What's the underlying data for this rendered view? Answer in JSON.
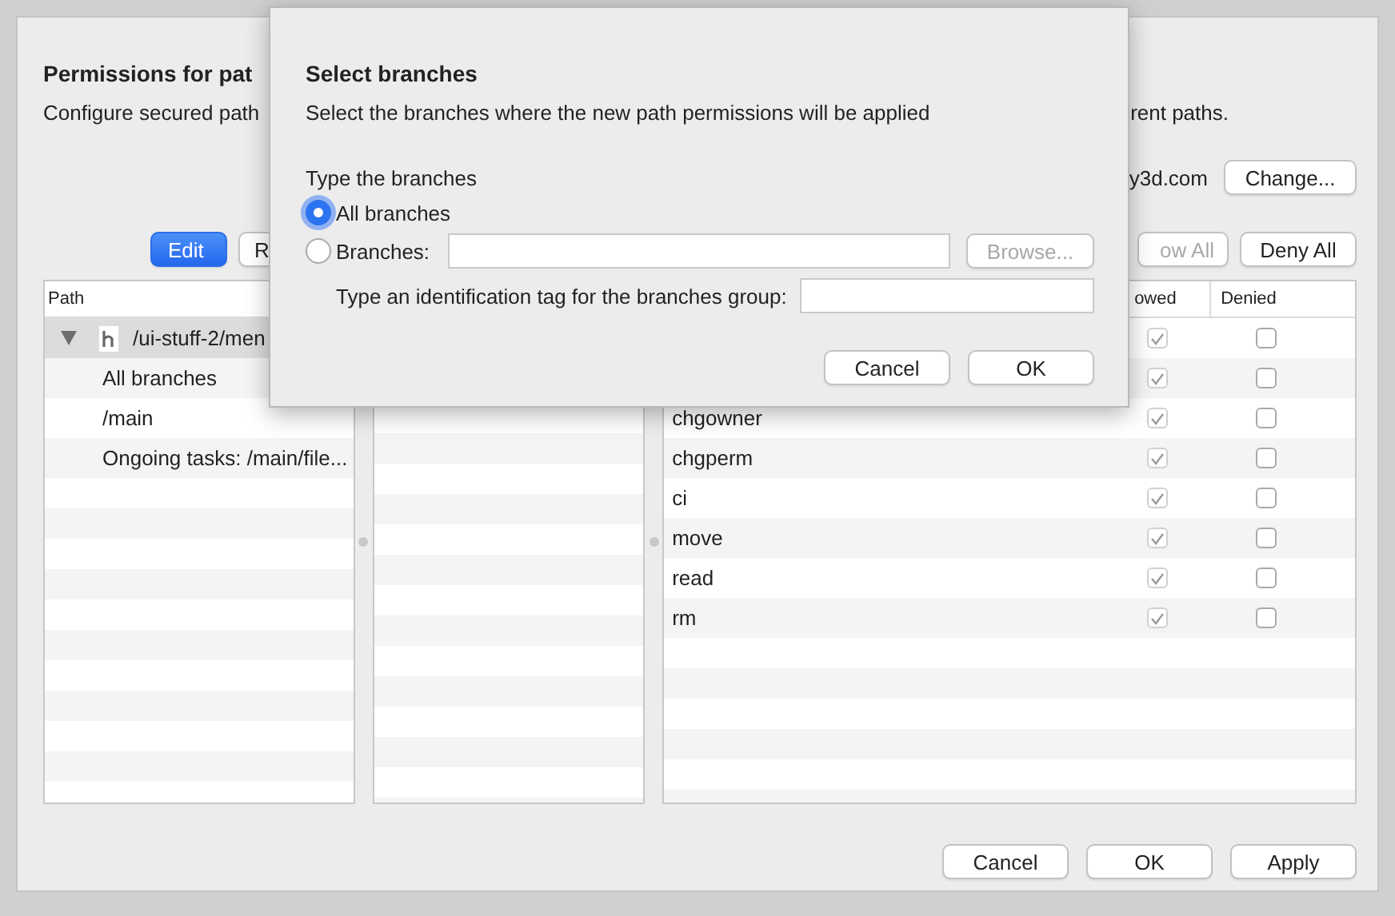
{
  "sheet": {
    "title": "Permissions for pat",
    "description": "Configure secured path",
    "description_end": "rent paths.",
    "account": "y3d.com",
    "change_button": "Change...",
    "toolbar_left": [
      {
        "label": "Edit",
        "kind": "primary"
      },
      {
        "label": "R",
        "kind": "normal"
      }
    ],
    "toolbar_right": [
      {
        "label": "ow All",
        "disabled": true
      },
      {
        "label": "Deny All",
        "disabled": false
      }
    ]
  },
  "path_table": {
    "columns": [
      "Path"
    ],
    "rows": [
      {
        "label": "/ui-stuff-2/men",
        "expanded": true,
        "selected": true,
        "children": [
          {
            "label": "All branches",
            "selected": false
          },
          {
            "label": "/main",
            "selected": false
          },
          {
            "label": "Ongoing tasks: /main/file...",
            "selected": false
          }
        ]
      }
    ]
  },
  "permissions": {
    "columns": [
      "owed",
      "Denied"
    ],
    "rows": [
      {
        "allowed": true,
        "denied": false
      },
      {
        "allowed": true,
        "denied": false
      },
      {
        "name": "chgowner",
        "allowed": true,
        "denied": false
      },
      {
        "name": "chgperm",
        "allowed": true,
        "denied": false
      },
      {
        "name": "ci",
        "allowed": true,
        "denied": false
      },
      {
        "name": "move",
        "allowed": true,
        "denied": false
      },
      {
        "name": "read",
        "allowed": true,
        "denied": false
      },
      {
        "name": "rm",
        "allowed": true,
        "denied": false
      }
    ]
  },
  "footer_buttons": [
    "Cancel",
    "OK",
    "Apply"
  ],
  "dialog": {
    "title": "Select branches",
    "description": "Select the branches where the new path permissions will be applied",
    "group_label": "Type the branches",
    "options": [
      {
        "label": "All branches",
        "selected": true
      },
      {
        "label": "Branches:",
        "selected": false
      }
    ],
    "browse_button": {
      "label": "Browse...",
      "disabled": true
    },
    "tag_label": "Type an identification tag for the branches group:",
    "buttons": [
      "Cancel",
      "OK"
    ]
  }
}
